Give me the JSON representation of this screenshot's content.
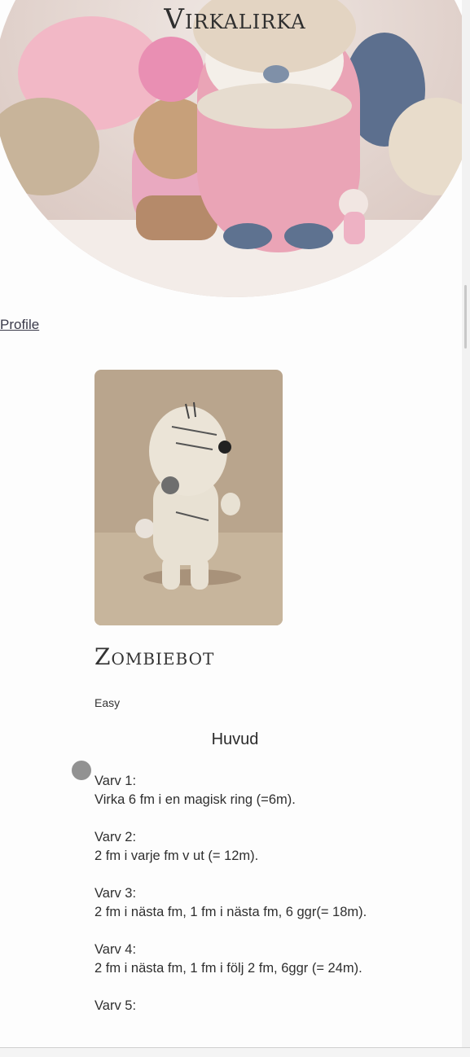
{
  "site": {
    "title": "Virkalirka"
  },
  "nav": {
    "profile_link": "Profile"
  },
  "hero": {
    "icon": "amigurumi-hero-image"
  },
  "pattern": {
    "image_icon": "zombie-amigurumi-photo",
    "title": "Zombiebot",
    "difficulty": "Easy",
    "section": "Huvud",
    "rows": [
      {
        "label": "Varv 1:",
        "text": "Virka 6 fm i en magisk ring (=6m)."
      },
      {
        "label": "Varv 2:",
        "text": "2 fm i varje fm v ut (= 12m)."
      },
      {
        "label": "Varv 3:",
        "text": "2 fm i nästa fm, 1 fm i nästa fm, 6 ggr(= 18m)."
      },
      {
        "label": "Varv 4:",
        "text": "2 fm i nästa fm, 1 fm i följ 2 fm, 6ggr (= 24m)."
      },
      {
        "label": "Varv 5:",
        "text": ""
      }
    ]
  },
  "colors": {
    "background": "#fdfdfd",
    "text": "#2b2b2b",
    "link": "#3a3a4a"
  }
}
